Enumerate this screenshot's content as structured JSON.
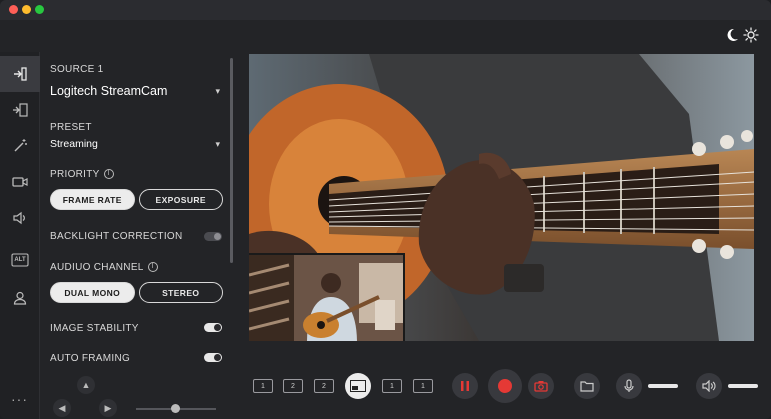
{
  "source": {
    "label": "SOURCE 1",
    "camera": "Logitech StreamCam"
  },
  "preset": {
    "label": "PRESET",
    "value": "Streaming"
  },
  "priority": {
    "label": "PRIORITY",
    "options": [
      "FRAME RATE",
      "EXPOSURE"
    ],
    "selected": "FRAME RATE"
  },
  "backlight": {
    "label": "BACKLIGHT CORRECTION",
    "enabled": false
  },
  "audio": {
    "label": "AUDIUO CHANNEL",
    "options": [
      "DUAL MONO",
      "STEREO"
    ],
    "selected": "DUAL MONO"
  },
  "stability": {
    "label": "IMAGE STABILITY",
    "enabled": true
  },
  "framing": {
    "label": "AUTO FRAMING",
    "enabled": true
  },
  "rail": {
    "alt_label": "ALT",
    "more": "···"
  },
  "layouts": [
    "1",
    "2",
    "2",
    "1",
    "1",
    "1"
  ],
  "colors": {
    "record": "#e53935",
    "accent": "#ececec",
    "background": "#232427"
  }
}
